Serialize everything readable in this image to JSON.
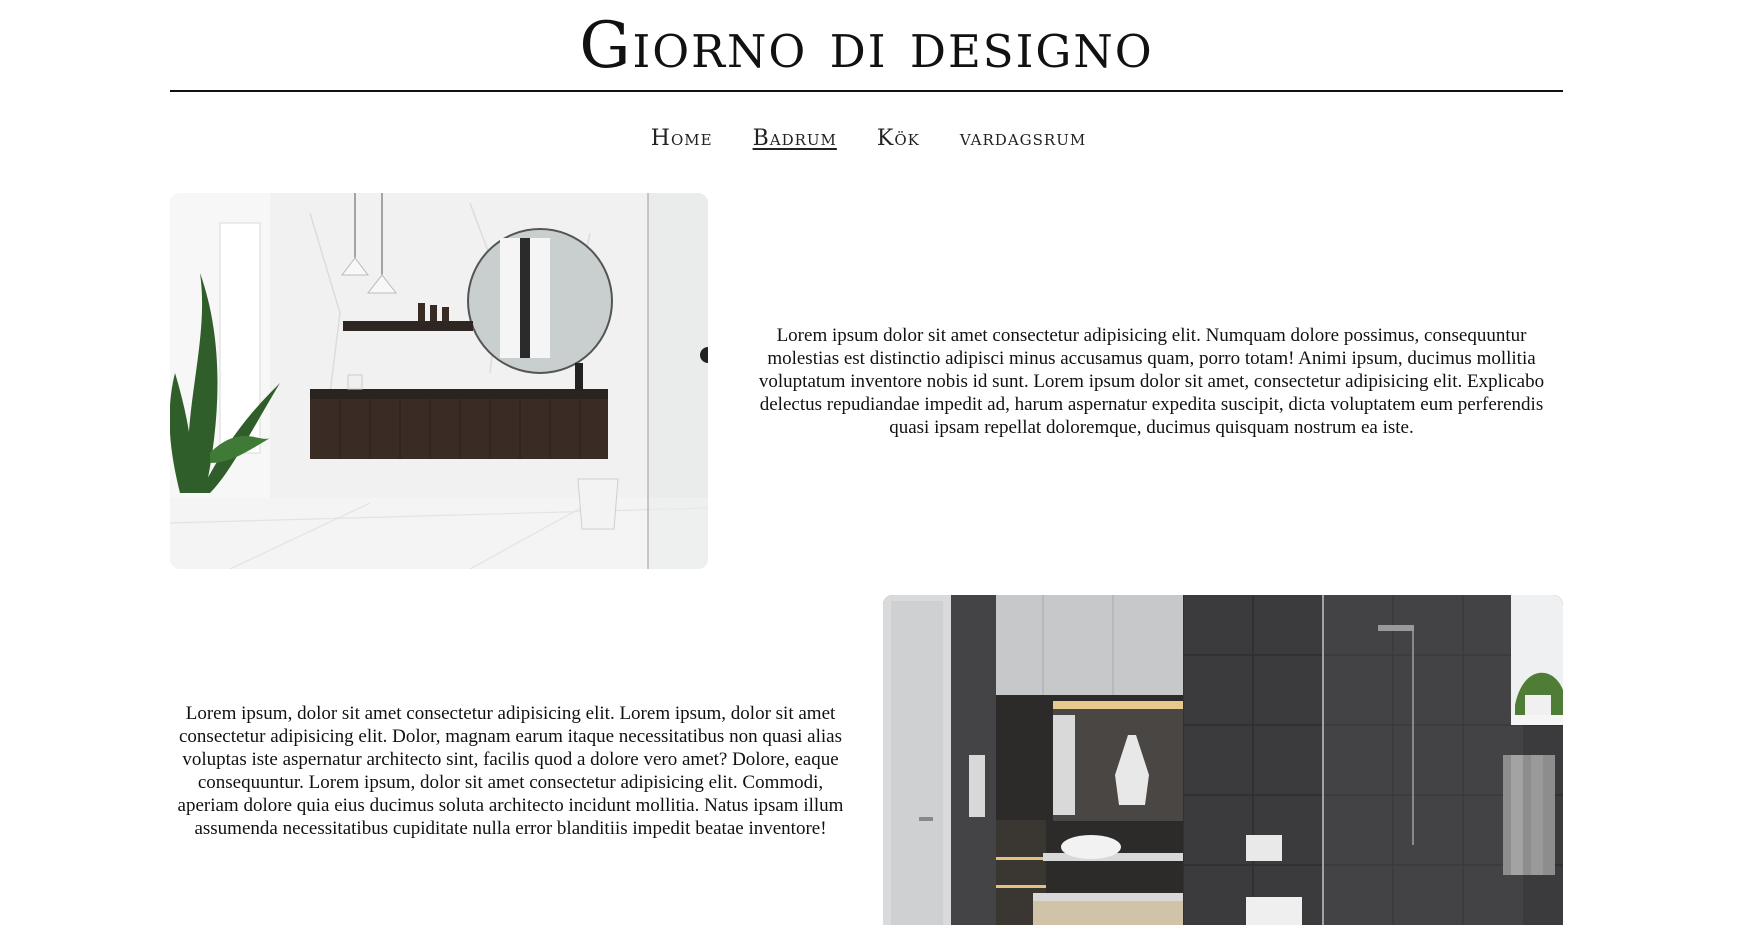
{
  "header": {
    "title": "Giorno di designo"
  },
  "nav": {
    "items": [
      {
        "label": "Home"
      },
      {
        "label": "Badrum"
      },
      {
        "label": "Kök"
      },
      {
        "label": "vardagsrum"
      }
    ],
    "active_index": 1
  },
  "sections": [
    {
      "image_icon": "bathroom-white-marble-photo",
      "text": "Lorem ipsum dolor sit amet consectetur adipisicing elit. Numquam dolore possimus, consequuntur molestias est distinctio adipisci minus accusamus quam, porro totam! Animi ipsum, ducimus mollitia voluptatum inventore nobis id sunt. Lorem ipsum dolor sit amet, consectetur adipisicing elit. Explicabo delectus repudiandae impedit ad, harum aspernatur expedita suscipit, dicta voluptatem eum perferendis quasi ipsam repellat doloremque, ducimus quisquam nostrum ea iste."
    },
    {
      "image_icon": "bathroom-dark-tile-photo",
      "text": "Lorem ipsum, dolor sit amet consectetur adipisicing elit. Lorem ipsum, dolor sit amet consectetur adipisicing elit. Dolor, magnam earum itaque necessitatibus non quasi alias voluptas iste aspernatur architecto sint, facilis quod a dolore vero amet? Dolore, eaque consequuntur. Lorem ipsum, dolor sit amet consectetur adipisicing elit. Commodi, aperiam dolore quia eius ducimus soluta architecto incidunt mollitia. Natus ipsam illum assumenda necessitatibus cupiditate nulla error blanditiis impedit beatae inventore!"
    }
  ],
  "colors": {
    "text": "#111111",
    "background": "#ffffff",
    "accent_wood": "#3a2c24",
    "dark_tile": "#3b3b3d"
  }
}
